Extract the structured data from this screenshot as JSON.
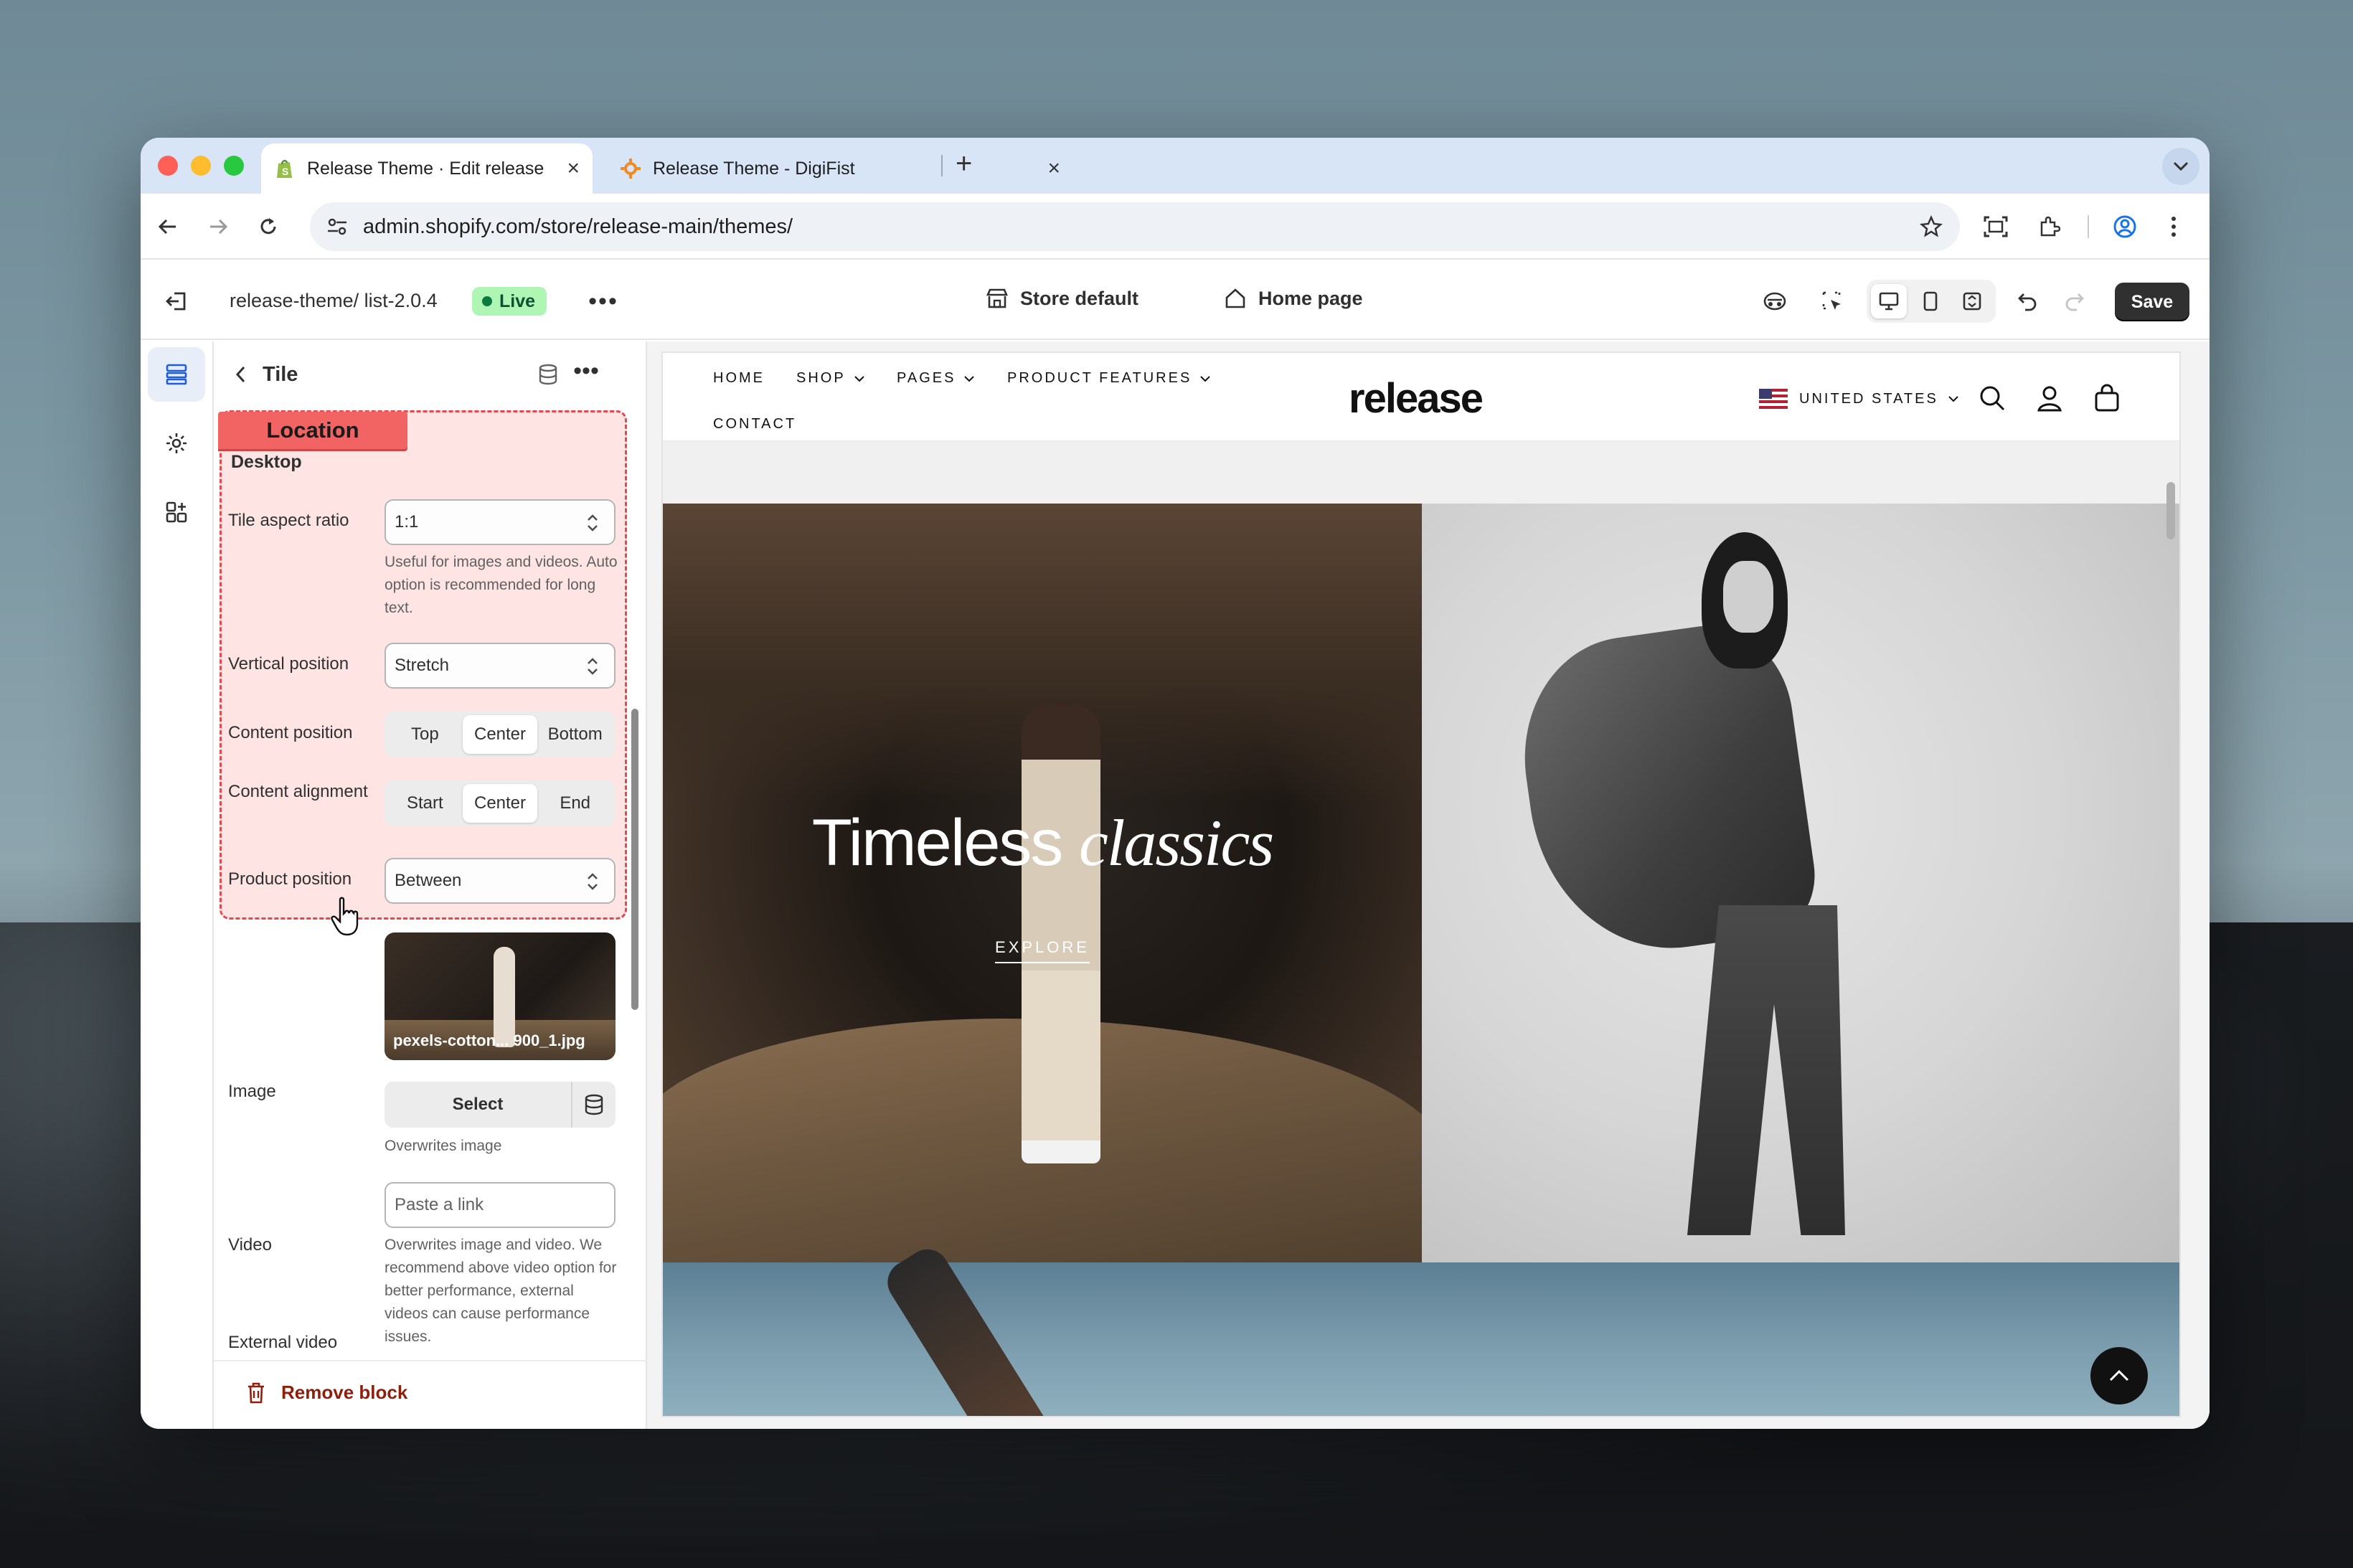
{
  "browser": {
    "tabs": [
      {
        "title": "Release Theme · Edit release",
        "active": true
      },
      {
        "title": "Release Theme - DigiFist",
        "active": false
      }
    ],
    "url": "admin.shopify.com/store/release-main/themes/"
  },
  "toolbar": {
    "theme_name": "release-theme/ list-2.0.4",
    "live_label": "Live",
    "store_default": "Store default",
    "home_page": "Home page",
    "save_label": "Save"
  },
  "panel": {
    "title": "Tile",
    "annotation_tag": "Location",
    "section": "Desktop",
    "tile_aspect_ratio": {
      "label": "Tile aspect ratio",
      "value": "1:1",
      "help": "Useful for images and videos. Auto option is recommended for long text."
    },
    "vertical_position": {
      "label": "Vertical position",
      "value": "Stretch"
    },
    "content_position": {
      "label": "Content position",
      "options": [
        "Top",
        "Center",
        "Bottom"
      ],
      "selected": "Center"
    },
    "content_alignment": {
      "label": "Content alignment",
      "options": [
        "Start",
        "Center",
        "End"
      ],
      "selected": "Center"
    },
    "product_position": {
      "label": "Product position",
      "value": "Between"
    },
    "image": {
      "label": "Image",
      "filename": "pexels-cotton... 900_1.jpg"
    },
    "video": {
      "label": "Video",
      "button": "Select",
      "help": "Overwrites image"
    },
    "external_video": {
      "label": "External video",
      "placeholder": "Paste a link",
      "help": "Overwrites image and video. We recommend above video option for better performance, external videos can cause performance issues."
    },
    "remove_block": "Remove block"
  },
  "store": {
    "nav": {
      "home": "HOME",
      "shop": "SHOP",
      "pages": "PAGES",
      "product_features": "PRODUCT FEATURES",
      "contact": "CONTACT"
    },
    "logo": "release",
    "country": "UNITED STATES",
    "hero": {
      "title_regular": "Timeless",
      "title_italic": "classics",
      "cta": "EXPLORE"
    }
  },
  "colors": {
    "accent_annotation": "#e5484d",
    "live_badge": "#aff5b4",
    "save_button": "#303030"
  }
}
